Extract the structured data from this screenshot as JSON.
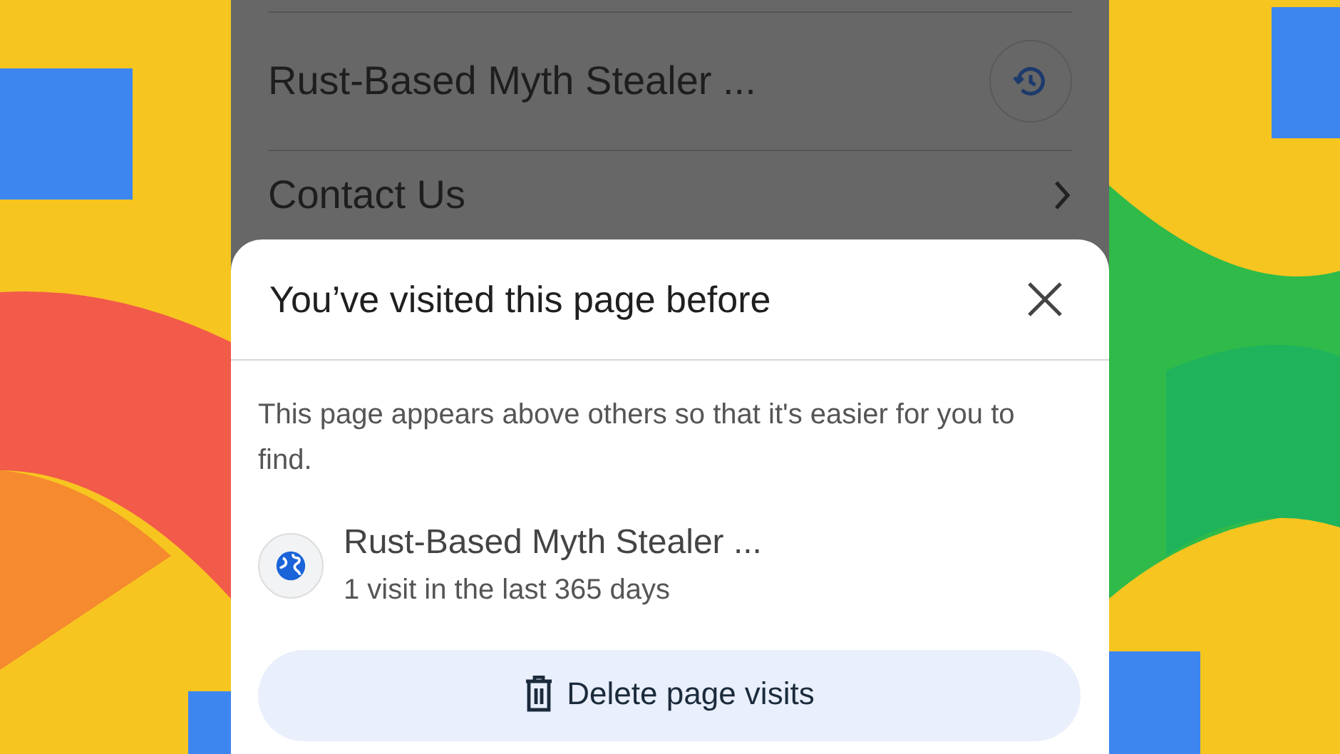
{
  "page": {
    "items": [
      {
        "title": "Rust-Based Myth Stealer ...",
        "kind": "history"
      },
      {
        "title": "Contact Us",
        "kind": "chevron"
      }
    ]
  },
  "sheet": {
    "title": "You’ve visited this page before",
    "description": "This page appears above others so that it's easier for you to find.",
    "site": {
      "title": "Rust-Based Myth Stealer ...",
      "subtitle": "1 visit in the last 365 days"
    },
    "button": "Delete page visits"
  }
}
